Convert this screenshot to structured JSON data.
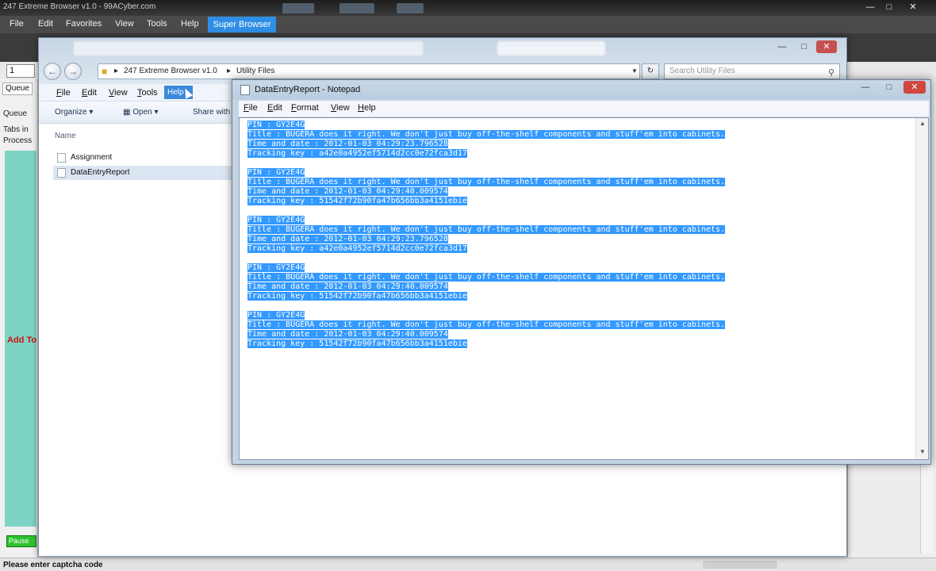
{
  "app": {
    "title": "247 Extreme Browser v1.0 - 99ACyber.com",
    "menu": [
      "File",
      "Edit",
      "Favorites",
      "View",
      "Tools",
      "Help"
    ],
    "super_browser": "Super Browser",
    "page_number": "1",
    "left_panel": {
      "tab_label": "Queue",
      "queue_label": "Queue",
      "tabs_in_label": "Tabs in",
      "process_label": "Process",
      "add_to": "Add To",
      "pause_button": "Pause"
    },
    "status": "Please enter captcha code"
  },
  "explorer": {
    "breadcrumbs": [
      "247 Extreme Browser v1.0",
      "Utility Files"
    ],
    "search_placeholder": "Search Utility Files",
    "menu": [
      {
        "key": "F",
        "rest": "ile"
      },
      {
        "key": "E",
        "rest": "dit"
      },
      {
        "key": "V",
        "rest": "iew"
      },
      {
        "key": "T",
        "rest": "ools"
      }
    ],
    "help_menu": "Help",
    "toolbar": {
      "organize": "Organize",
      "open": "Open",
      "share_with": "Share with"
    },
    "column_header": "Name",
    "files": [
      "Assignment",
      "DataEntryReport"
    ]
  },
  "notepad": {
    "title": "DataEntryReport - Notepad",
    "menu": [
      {
        "key": "F",
        "rest": "ile"
      },
      {
        "key": "E",
        "rest": "dit"
      },
      {
        "key": "F",
        "rest": "ormat",
        "pre": ""
      },
      {
        "key": "V",
        "rest": "iew"
      },
      {
        "key": "H",
        "rest": "elp"
      }
    ],
    "lines": [
      "PIN : GY2E4G",
      "Title : BUGERA does it right. We don't just buy off-the-shelf components and stuff'em into cabinets.",
      "Time and date : 2012-01-03 04:29:23.796528",
      "Tracking key : a42e0a4952ef5714d2cc0e72fca3d17",
      "",
      "PIN : GY2E4G",
      "Title : BUGERA does it right. We don't just buy off-the-shelf components and stuff'em into cabinets.",
      "Time and date : 2012-01-03 04:29:40.009574",
      "Tracking key : 51542f72b90fa47b656bb3a4151ebie",
      "",
      "PIN : GY2E4G",
      "Title : BUGERA does it right. We don't just buy off-the-shelf components and stuff'em into cabinets.",
      "Time and date : 2012-01-03 04:29:23.796528",
      "Tracking key : a42e0a4952ef5714d2cc0e72fca3d17",
      "",
      "PIN : GY2E4G",
      "Title : BUGERA does it right. We don't just buy off-the-shelf components and stuff'em into cabinets.",
      "Time and date : 2012-01-03 04:29:40.009574",
      "Tracking key : 51542f72b90fa47b656bb3a4151ebie",
      "",
      "PIN : GY2E4G",
      "Title : BUGERA does it right. We don't just buy off-the-shelf components and stuff'em into cabinets.",
      "Time and date : 2012-01-03 04:29:40.009574",
      "Tracking key : 51542f72b90fa47b656bb3a4151ebie"
    ]
  },
  "colors": {
    "selection": "#3399ff",
    "super_browser_bg": "#2f8fe6",
    "teal_panel": "#7dd4c4",
    "add_to_text": "#d01010",
    "pause_button_bg": "#2ec12e"
  }
}
